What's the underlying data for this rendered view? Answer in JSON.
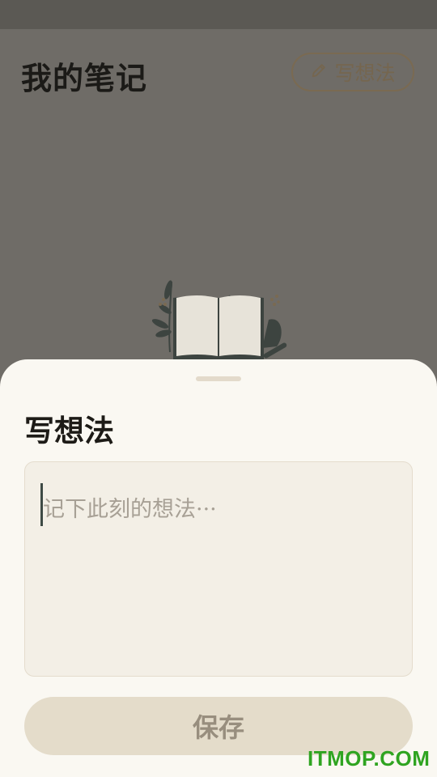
{
  "header": {
    "title": "我的笔记",
    "write_button_label": "写想法",
    "write_icon": "pencil-icon"
  },
  "sheet": {
    "title": "写想法",
    "input": {
      "value": "",
      "placeholder": "记下此刻的想法···"
    },
    "save_label": "保存"
  },
  "watermark": "ITMOP.COM",
  "colors": {
    "backdrop": "#6f6c67",
    "sheet_background": "#faf8f2",
    "accent_brown": "#75664f",
    "save_button": "#e4dcca",
    "watermark": "#2fa421"
  }
}
